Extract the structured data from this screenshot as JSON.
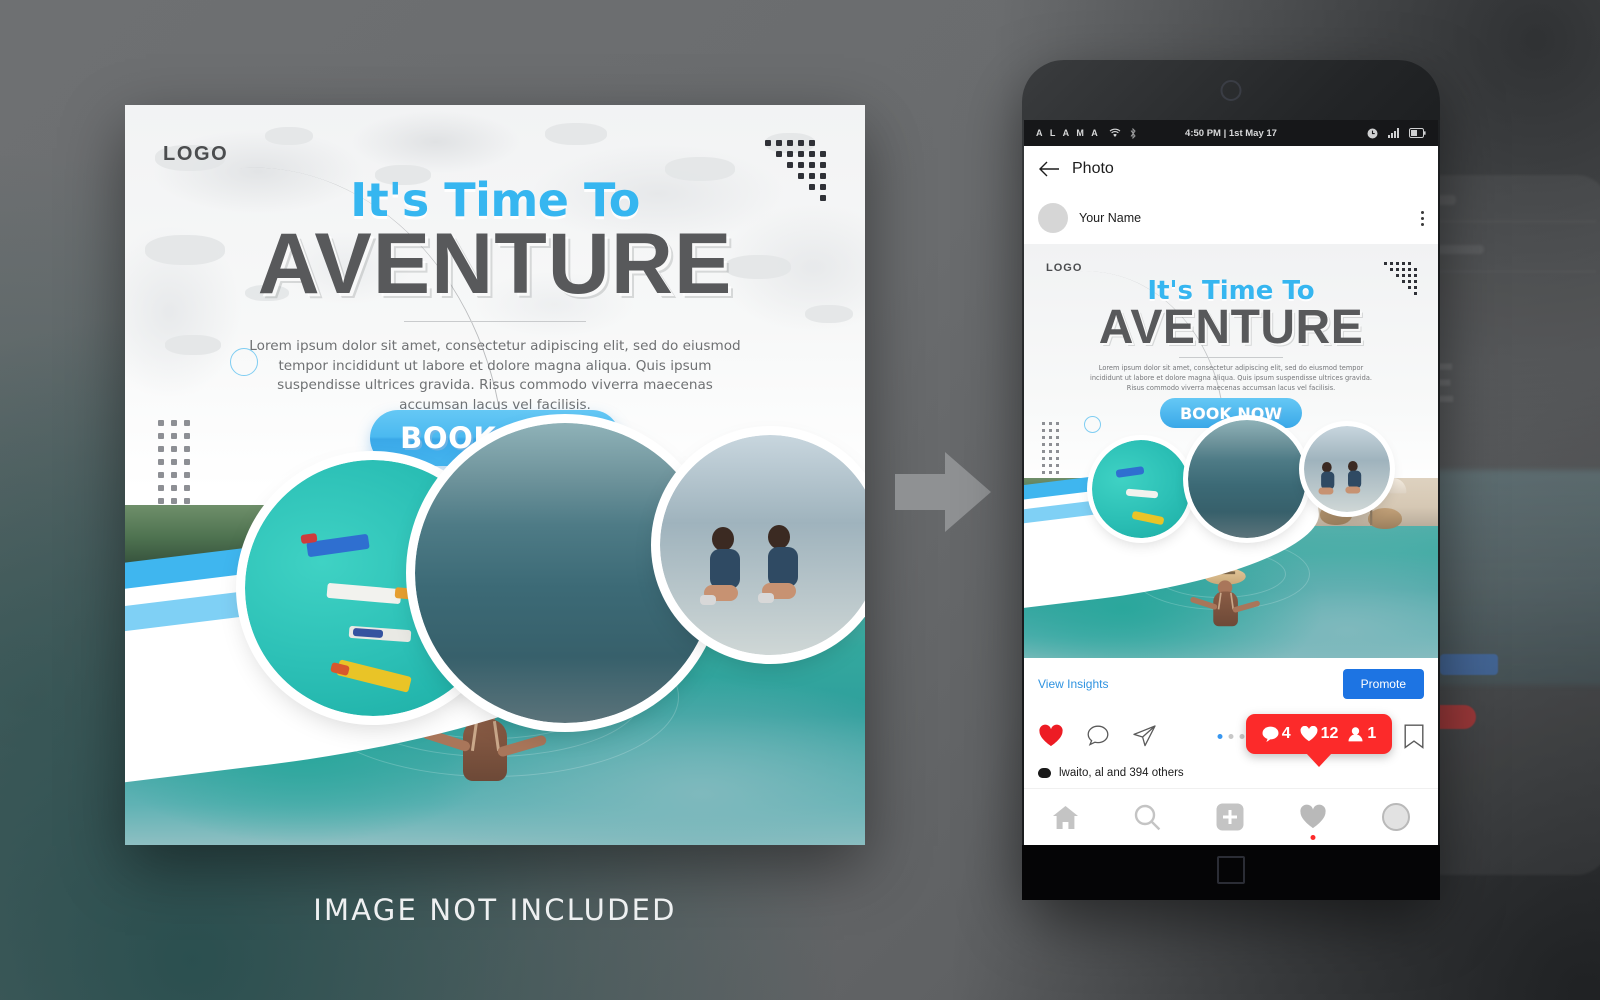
{
  "caption": "IMAGE NOT INCLUDED",
  "poster": {
    "logo": "LOGO",
    "headline_sub": "It's Time To",
    "headline_main": "AVENTURE",
    "body": "Lorem ipsum dolor sit amet, consectetur adipiscing elit, sed do eiusmod tempor incididunt ut labore et dolore magna aliqua. Quis ipsum suspendisse ultrices gravida. Risus commodo viverra maecenas accumsan lacus vel facilisis.",
    "cta": "BOOK NOW",
    "colors": {
      "accent_blue": "#36b6f0",
      "headline_gray": "#58595b",
      "cta_blue": "#4bb9f0",
      "ribbon_blue": "#3fb6ef",
      "ribbon_light": "#7fd0f5"
    }
  },
  "arrow": {
    "icon": "arrow-right-icon"
  },
  "phone": {
    "statusbar": {
      "carrier": "A L A M A",
      "wifi_icon": "wifi-icon",
      "bluetooth_icon": "bluetooth-icon",
      "time": "4:50 PM | 1st May 17",
      "clock_icon": "clock-icon",
      "signal_icon": "signal-icon",
      "battery_icon": "battery-icon"
    },
    "header": {
      "back_icon": "back-arrow-icon",
      "title": "Photo"
    },
    "post_user": {
      "avatar": "user-avatar",
      "name": "Your Name",
      "more_icon": "more-vertical-icon"
    },
    "actions": {
      "view_insights": "View Insights",
      "promote": "Promote"
    },
    "icons": {
      "like": "heart-icon",
      "comment": "comment-icon",
      "share": "share-icon",
      "bookmark": "bookmark-icon"
    },
    "carousel_dots": 3,
    "carousel_active": 0,
    "badge": {
      "comments": "4",
      "likes": "12",
      "followers": "1",
      "color": "#fc2a2a"
    },
    "likes_text": "lwaito, al  and 394 others",
    "nav": {
      "home": "home-icon",
      "search": "search-icon",
      "add": "add-post-icon",
      "activity": "heart-icon",
      "profile": "profile-icon"
    },
    "home_button": "home-square-icon"
  }
}
